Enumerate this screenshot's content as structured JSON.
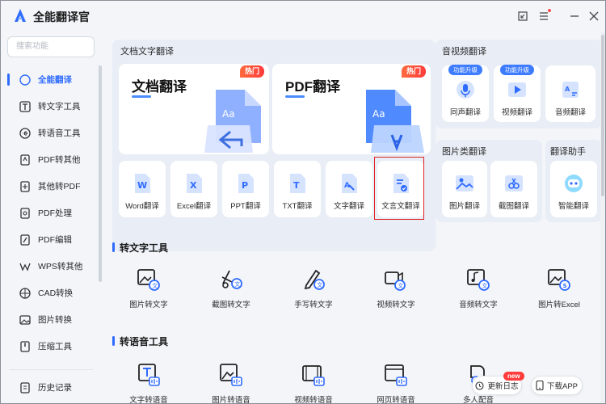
{
  "app": {
    "title": "全能翻译官"
  },
  "titlebar": {
    "icons": [
      "minimize-to-tray-icon",
      "menu-icon",
      "minimize-icon",
      "close-icon"
    ]
  },
  "search": {
    "placeholder": "搜索功能"
  },
  "sidebar": {
    "items": [
      {
        "label": "全能翻译",
        "active": true
      },
      {
        "label": "转文字工具"
      },
      {
        "label": "转语音工具"
      },
      {
        "label": "PDF转其他"
      },
      {
        "label": "其他转PDF"
      },
      {
        "label": "PDF处理"
      },
      {
        "label": "PDF编辑"
      },
      {
        "label": "WPS转其他"
      },
      {
        "label": "CAD转换"
      },
      {
        "label": "图片转换"
      },
      {
        "label": "压缩工具"
      }
    ],
    "history": "历史记录"
  },
  "doc_panel": {
    "title": "文档文字翻译",
    "cards": [
      {
        "title": "文档翻译",
        "badge": "热门"
      },
      {
        "title": "PDF翻译",
        "badge": "热门"
      }
    ],
    "tools": [
      "Word翻译",
      "Excel翻译",
      "PPT翻译",
      "TXT翻译",
      "文字翻译",
      "文言文翻译"
    ]
  },
  "av_panel": {
    "title": "音视频翻译",
    "tools": [
      {
        "label": "同声翻译",
        "badge": "功能升级"
      },
      {
        "label": "视频翻译",
        "badge": "功能升级"
      },
      {
        "label": "音频翻译"
      }
    ]
  },
  "img_panel": {
    "title": "图片类翻译",
    "tools": [
      "图片翻译",
      "截图翻译"
    ]
  },
  "assistant_panel": {
    "title": "翻译助手",
    "tools": [
      "智能翻译"
    ]
  },
  "sections": [
    {
      "title": "转文字工具",
      "items": [
        "图片转文字",
        "截图转文字",
        "手写转文字",
        "视频转文字",
        "音频转文字",
        "图片转Excel"
      ]
    },
    {
      "title": "转语音工具",
      "items": [
        "文字转语音",
        "图片转语音",
        "视频转语音",
        "网页转语音",
        "多人配音"
      ]
    }
  ],
  "floating": {
    "changelog": "更新日志",
    "changelog_badge": "new",
    "download": "下载APP"
  },
  "colors": {
    "accent": "#2f6bff",
    "hot": "#ff4d3b",
    "panel": "#e8edf6",
    "highlight": "#e02424"
  }
}
